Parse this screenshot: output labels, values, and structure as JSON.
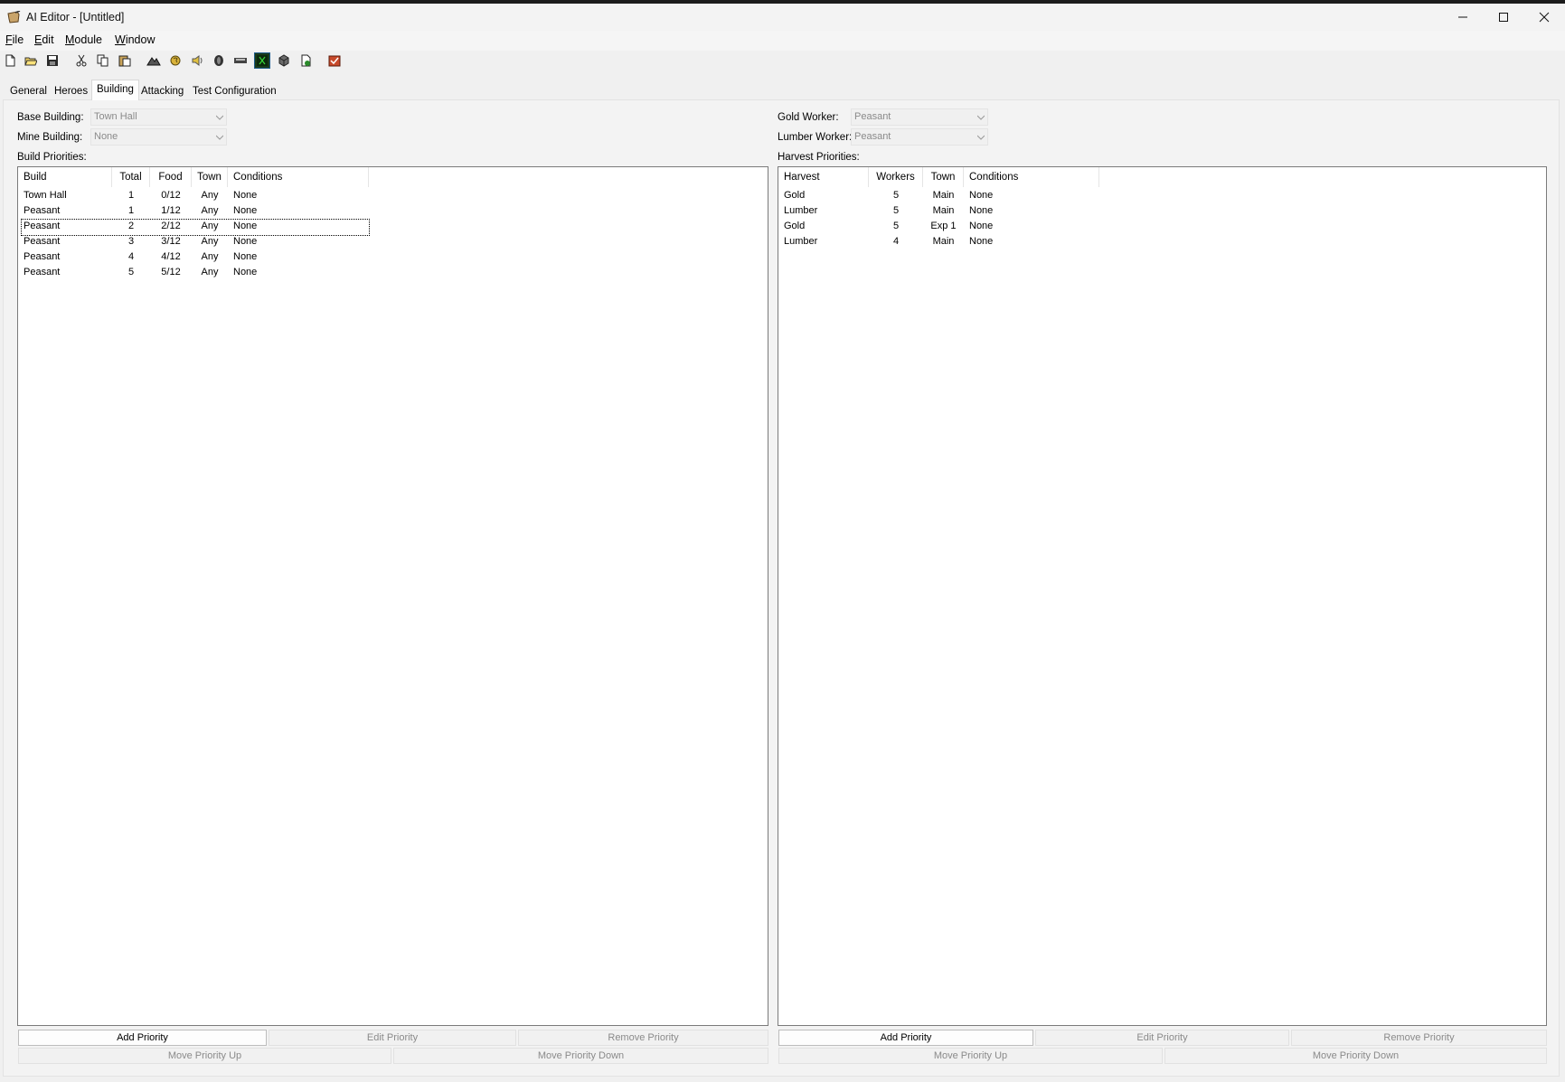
{
  "window": {
    "title": "AI Editor - [Untitled]",
    "controls": [
      "minimize-icon",
      "maximize-icon",
      "close-icon"
    ]
  },
  "menu": [
    {
      "label": "File",
      "accel": "F",
      "rest": "ile"
    },
    {
      "label": "Edit",
      "accel": "E",
      "rest": "dit"
    },
    {
      "label": "Module",
      "accel": "M",
      "rest": "odule"
    },
    {
      "label": "Window",
      "accel": "W",
      "rest": "indow"
    }
  ],
  "toolbar": {
    "icons": [
      "new-file-icon",
      "open-folder-icon",
      "save-icon",
      "cut-icon",
      "copy-icon",
      "paste-icon",
      "terrain-editor-icon",
      "trigger-editor-icon",
      "sound-editor-icon",
      "object-editor-icon",
      "campaign-editor-icon",
      "ai-editor-icon",
      "object-manager-icon",
      "import-manager-icon",
      "test-map-icon"
    ],
    "active": "ai-editor-icon"
  },
  "tabs": [
    "General",
    "Heroes",
    "Building",
    "Attacking",
    "Test Configuration"
  ],
  "active_tab": "Building",
  "left": {
    "base_building_label": "Base Building:",
    "base_building_value": "Town Hall",
    "mine_building_label": "Mine Building:",
    "mine_building_value": "None",
    "list_label": "Build Priorities:",
    "columns": [
      "Build",
      "Total",
      "Food",
      "Town",
      "Conditions"
    ],
    "rows": [
      {
        "build": "Town Hall",
        "total": "1",
        "food": "0/12",
        "town": "Any",
        "conditions": "None"
      },
      {
        "build": "Peasant",
        "total": "1",
        "food": "1/12",
        "town": "Any",
        "conditions": "None"
      },
      {
        "build": "Peasant",
        "total": "2",
        "food": "2/12",
        "town": "Any",
        "conditions": "None"
      },
      {
        "build": "Peasant",
        "total": "3",
        "food": "3/12",
        "town": "Any",
        "conditions": "None"
      },
      {
        "build": "Peasant",
        "total": "4",
        "food": "4/12",
        "town": "Any",
        "conditions": "None"
      },
      {
        "build": "Peasant",
        "total": "5",
        "food": "5/12",
        "town": "Any",
        "conditions": "None"
      }
    ],
    "focused_row": 2,
    "buttons": {
      "add": "Add Priority",
      "edit": "Edit Priority",
      "remove": "Remove Priority",
      "up": "Move Priority Up",
      "down": "Move Priority Down"
    }
  },
  "right": {
    "gold_worker_label": "Gold Worker:",
    "gold_worker_value": "Peasant",
    "lumber_worker_label": "Lumber Worker:",
    "lumber_worker_value": "Peasant",
    "list_label": "Harvest Priorities:",
    "columns": [
      "Harvest",
      "Workers",
      "Town",
      "Conditions"
    ],
    "rows": [
      {
        "harvest": "Gold",
        "workers": "5",
        "town": "Main",
        "conditions": "None"
      },
      {
        "harvest": "Lumber",
        "workers": "5",
        "town": "Main",
        "conditions": "None"
      },
      {
        "harvest": "Gold",
        "workers": "5",
        "town": "Exp 1",
        "conditions": "None"
      },
      {
        "harvest": "Lumber",
        "workers": "4",
        "town": "Main",
        "conditions": "None"
      }
    ],
    "buttons": {
      "add": "Add Priority",
      "edit": "Edit Priority",
      "remove": "Remove Priority",
      "up": "Move Priority Up",
      "down": "Move Priority Down"
    }
  }
}
